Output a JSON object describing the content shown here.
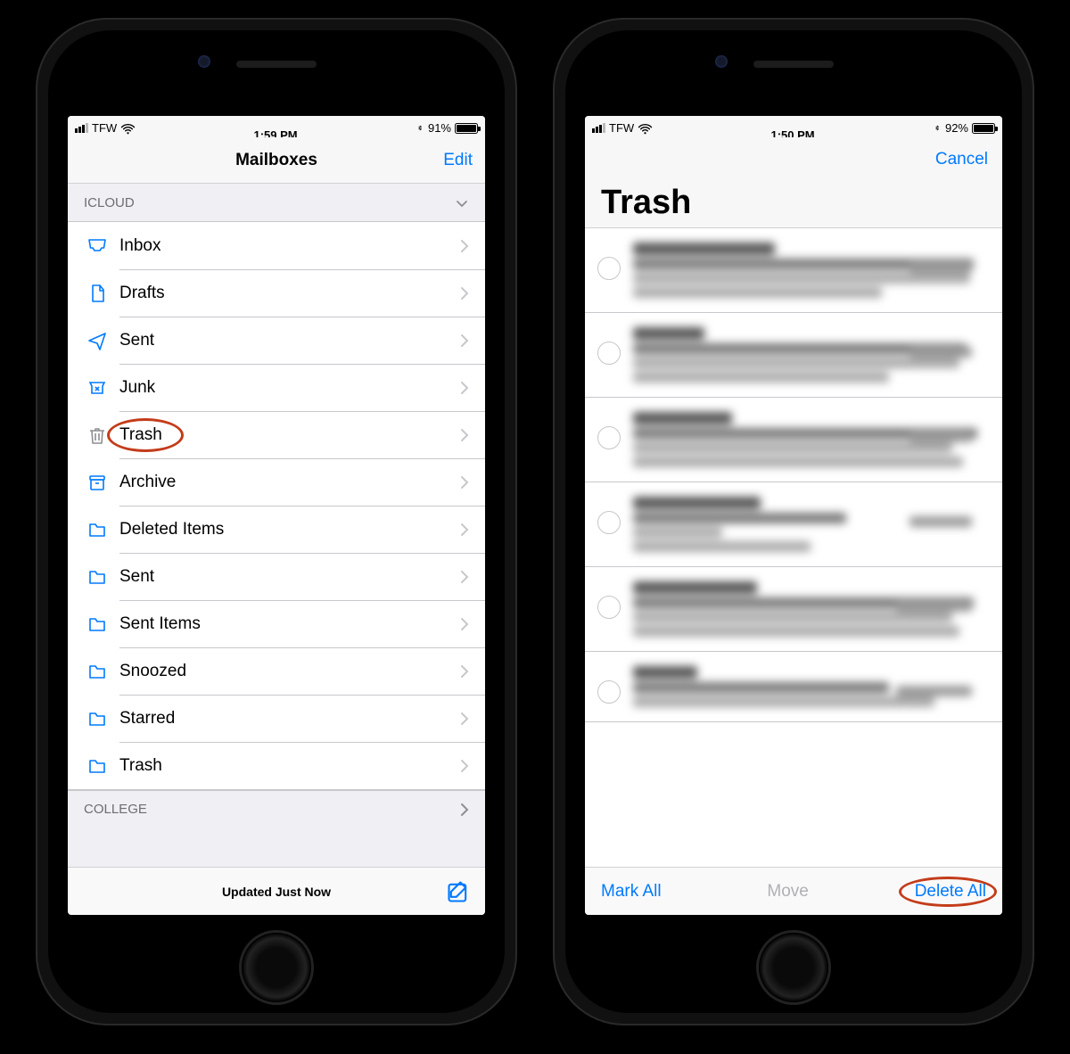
{
  "phone1": {
    "status": {
      "carrier": "TFW",
      "time": "1:59 PM",
      "battery_pct": "91%"
    },
    "nav": {
      "title": "Mailboxes",
      "edit": "Edit"
    },
    "sections": [
      {
        "header": "ICLOUD",
        "collapsible": true,
        "items": [
          {
            "icon": "inbox",
            "label": "Inbox"
          },
          {
            "icon": "draft",
            "label": "Drafts"
          },
          {
            "icon": "sent",
            "label": "Sent"
          },
          {
            "icon": "junk",
            "label": "Junk"
          },
          {
            "icon": "trash",
            "label": "Trash",
            "highlighted": true
          },
          {
            "icon": "archive",
            "label": "Archive"
          },
          {
            "icon": "folder",
            "label": "Deleted Items"
          },
          {
            "icon": "folder",
            "label": "Sent"
          },
          {
            "icon": "folder",
            "label": "Sent Items"
          },
          {
            "icon": "folder",
            "label": "Snoozed"
          },
          {
            "icon": "folder",
            "label": "Starred"
          },
          {
            "icon": "folder",
            "label": "Trash"
          }
        ]
      },
      {
        "header": "COLLEGE",
        "collapsible": false
      }
    ],
    "toolbar": {
      "status": "Updated Just Now"
    }
  },
  "phone2": {
    "status": {
      "carrier": "TFW",
      "time": "1:50 PM",
      "battery_pct": "92%"
    },
    "nav": {
      "cancel": "Cancel",
      "title": "Trash"
    },
    "emails": [
      {
        "date": "Thursday",
        "lines": 3
      },
      {
        "date": "Thursday",
        "lines": 3
      },
      {
        "date": "Thursday",
        "lines": 3
      },
      {
        "date": "Thursday",
        "lines": 3
      },
      {
        "date": "Wednesday",
        "lines": 3
      },
      {
        "date": "Wednesday",
        "lines": 2
      }
    ],
    "toolbar": {
      "mark_all": "Mark All",
      "move": "Move",
      "delete_all": "Delete All"
    }
  }
}
